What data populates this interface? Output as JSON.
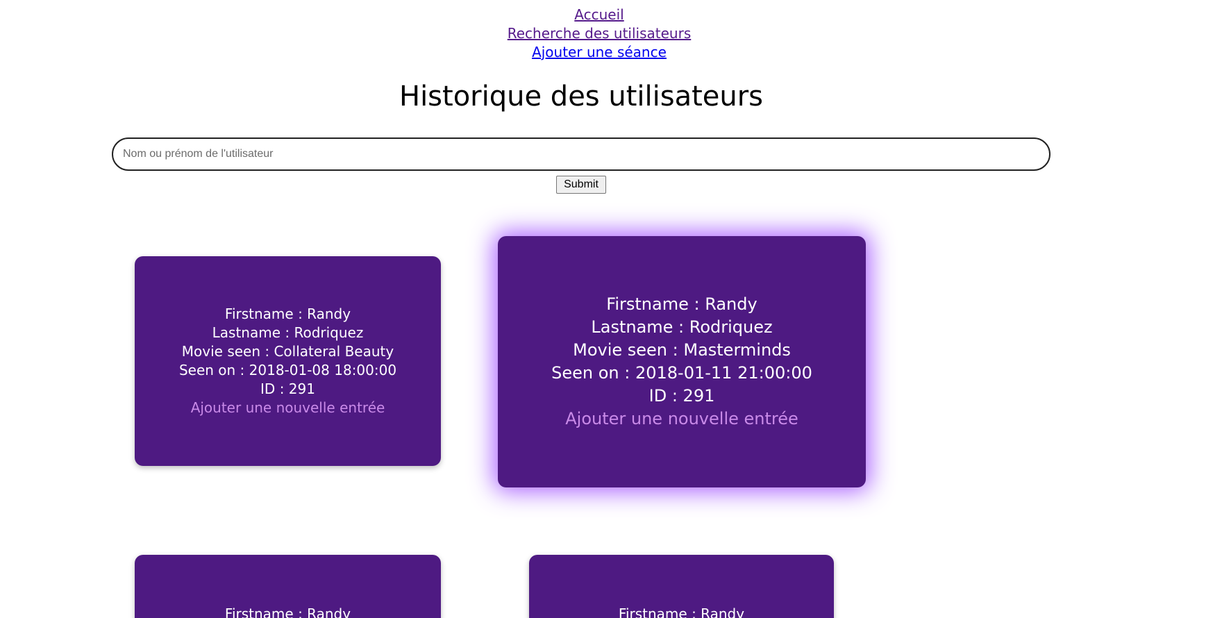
{
  "nav": {
    "home": "Accueil",
    "search_users": "Recherche des utilisateurs",
    "add_session": "Ajouter une séance"
  },
  "page_title": "Historique des utilisateurs",
  "search": {
    "placeholder": "Nom ou prénom de l'utilisateur",
    "value": ""
  },
  "submit_label": "Submit",
  "cards": [
    {
      "firstname": "Firstname : Randy",
      "lastname": "Lastname : Rodriquez",
      "movie": "Movie seen : Collateral Beauty",
      "seen_on": "Seen on : 2018-01-08 18:00:00",
      "id": "ID : 291",
      "add_link": "Ajouter une nouvelle entrée"
    },
    {
      "firstname": "Firstname : Randy",
      "lastname": "Lastname : Rodriquez",
      "movie": "Movie seen : Masterminds",
      "seen_on": "Seen on : 2018-01-11 21:00:00",
      "id": "ID : 291",
      "add_link": "Ajouter une nouvelle entrée"
    },
    {
      "firstname": "Firstname : Randy"
    },
    {
      "firstname": "Firstname : Randy"
    }
  ],
  "colors": {
    "card_background": "#4e1a82",
    "card_link": "#c98ae8",
    "hover_glow": "#9b46ff"
  }
}
